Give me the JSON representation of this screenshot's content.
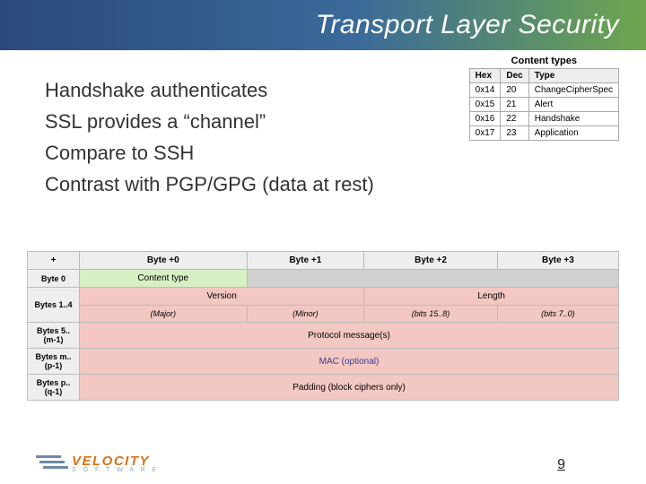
{
  "title": "Transport Layer Security",
  "bullets": [
    "Handshake authenticates",
    "SSL provides a “channel”",
    "Compare to SSH",
    "Contrast with PGP/GPG (data at rest)"
  ],
  "content_types": {
    "caption": "Content types",
    "headers": [
      "Hex",
      "Dec",
      "Type"
    ],
    "rows": [
      [
        "0x14",
        "20",
        "ChangeCipherSpec"
      ],
      [
        "0x15",
        "21",
        "Alert"
      ],
      [
        "0x16",
        "22",
        "Handshake"
      ],
      [
        "0x17",
        "23",
        "Application"
      ]
    ]
  },
  "record_layout": {
    "col_headers": [
      "+",
      "Byte +0",
      "Byte +1",
      "Byte +2",
      "Byte +3"
    ],
    "rows": [
      {
        "label": "Byte 0",
        "cells": [
          {
            "text": "Content type",
            "span": 1,
            "cls": "green"
          },
          {
            "text": "",
            "span": 3,
            "cls": "gray"
          }
        ]
      },
      {
        "label": "Bytes 1..4",
        "cells": [
          {
            "text": "Version",
            "span": 2,
            "cls": "pink"
          },
          {
            "text": "Length",
            "span": 2,
            "cls": "pink"
          }
        ],
        "sub": [
          "(Major)",
          "(Minor)",
          "(bits 15..8)",
          "(bits 7..0)"
        ]
      },
      {
        "label": "Bytes 5..(m-1)",
        "cells": [
          {
            "text": "Protocol message(s)",
            "span": 4,
            "cls": "pink"
          }
        ]
      },
      {
        "label": "Bytes m..(p-1)",
        "cells": [
          {
            "text": "MAC (optional)",
            "span": 4,
            "cls": "pink"
          }
        ]
      },
      {
        "label": "Bytes p..(q-1)",
        "cells": [
          {
            "text": "Padding (block ciphers only)",
            "span": 4,
            "cls": "pink"
          }
        ]
      }
    ]
  },
  "logo": {
    "name": "VELOCITY",
    "sub": "S O F T W A R E"
  },
  "page_number": "9"
}
